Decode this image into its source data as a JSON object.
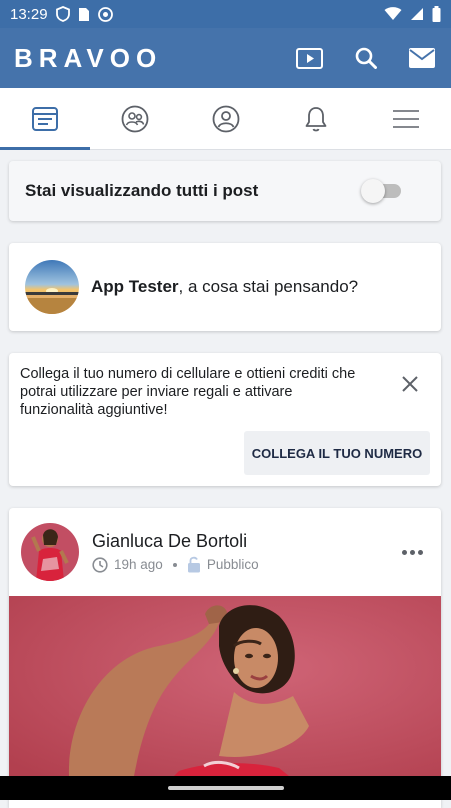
{
  "status_bar": {
    "time": "13:29"
  },
  "app": {
    "logo": "BRAVOO",
    "brand_color": "#4573ab"
  },
  "tabs": [
    {
      "icon": "feed-icon",
      "active": true
    },
    {
      "icon": "friends-icon",
      "active": false
    },
    {
      "icon": "profile-icon",
      "active": false
    },
    {
      "icon": "bell-icon",
      "active": false
    },
    {
      "icon": "menu-icon",
      "active": false
    }
  ],
  "filter": {
    "label": "Stai visualizzando tutti i post",
    "toggle_on": false
  },
  "composer": {
    "user_name": "App Tester",
    "prompt": ", a cosa stai pensando?"
  },
  "promo": {
    "text": "Collega il tuo numero di cellulare e ottieni crediti che potrai utilizzare per inviare regali e attivare funzionalità aggiuntive!",
    "button_label": "COLLEGA IL TUO NUMERO"
  },
  "post": {
    "author": "Gianluca De Bortoli",
    "time": "19h ago",
    "visibility": "Pubblico"
  }
}
